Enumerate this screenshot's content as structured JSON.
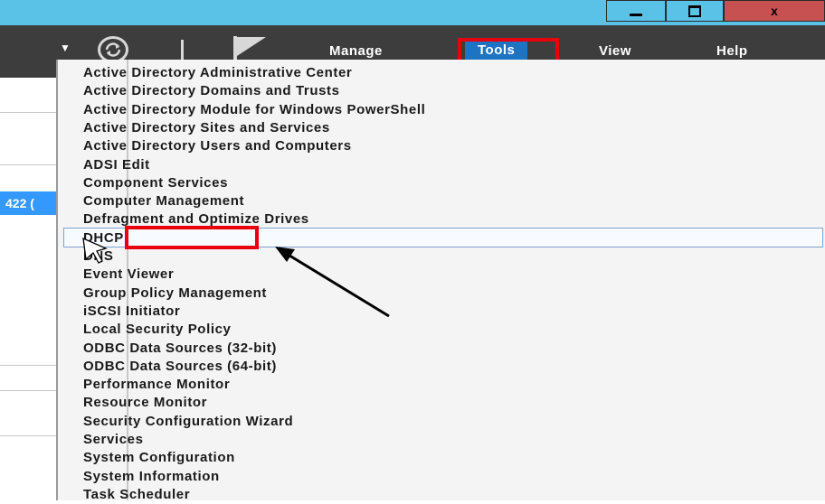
{
  "window": {
    "minimize_icon": "minimize-icon",
    "restore_icon": "restore-icon",
    "close_label": "x"
  },
  "toolbar": {
    "manage": "Manage",
    "tools": "Tools",
    "view": "View",
    "help": "Help",
    "icons": [
      "dropdown-arrow-icon",
      "refresh-icon",
      "flag-icon"
    ]
  },
  "left_pane": {
    "selected_text": "422 ("
  },
  "menu": {
    "items": [
      "Active Directory Administrative Center",
      "Active Directory Domains and Trusts",
      "Active Directory Module for Windows PowerShell",
      "Active Directory Sites and Services",
      "Active Directory Users and Computers",
      "ADSI Edit",
      "Component Services",
      "Computer Management",
      "Defragment and Optimize Drives",
      "DHCP",
      "DNS",
      "Event Viewer",
      "Group Policy Management",
      "iSCSI Initiator",
      "Local Security Policy",
      "ODBC Data Sources (32-bit)",
      "ODBC Data Sources (64-bit)",
      "Performance Monitor",
      "Resource Monitor",
      "Security Configuration Wizard",
      "Services",
      "System Configuration",
      "System Information",
      "Task Scheduler"
    ],
    "hovered_index": 9
  },
  "colors": {
    "titlebar": "#5bc2e7",
    "toolbar": "#3d3d3d",
    "tools_highlight": "#1e73c3",
    "annotation_red": "#e8000b",
    "menu_bg": "#f4f4f4"
  }
}
